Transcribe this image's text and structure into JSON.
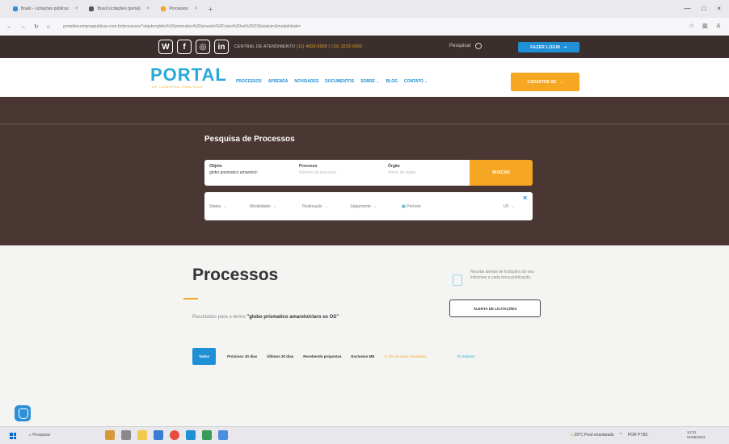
{
  "browser": {
    "tabs": [
      {
        "title": "Brasil - Licitações públicas",
        "color": "#2d8fd6"
      },
      {
        "title": "Brasil Licitações (portal)",
        "color": "#555555"
      },
      {
        "title": "Processos",
        "color": "#f5a623"
      }
    ],
    "url": "portaldecompraspublicas.com.br/processos?objeto=globo%20prismatico%20amarelo%2Fclaro%20so%20OS&status=&modalidade=",
    "window_controls": [
      "—",
      "□",
      "×"
    ]
  },
  "topbar": {
    "social": [
      "W",
      "f",
      "◎",
      "in"
    ],
    "central": "CENTRAL DE ATENDIMENTO",
    "phone": "(11) 4003-0000 / (19) 3232-0000",
    "search_label": "Pesquisar",
    "login_label": "FAZER LOGIN"
  },
  "header": {
    "logo": "PORTAL",
    "logo_sub": "DE COMPRAS PÚBLICAS",
    "menu": [
      "PROCESSOS",
      "APRENDA",
      "NOVIDADES",
      "DOCUMENTOS",
      "SOBRE",
      "BLOG",
      "CONTATO"
    ],
    "register_label": "CADASTRE-SE"
  },
  "search": {
    "title": "Pesquisa de Processos",
    "fields": [
      {
        "label": "Objeto",
        "value": "globo prismatico amarelo/c",
        "placeholder": ""
      },
      {
        "label": "Processo",
        "value": "",
        "placeholder": "Número do processo"
      },
      {
        "label": "Órgão",
        "value": "",
        "placeholder": "Nome do órgão"
      }
    ],
    "button": "BUSCAR",
    "filters": [
      "Status",
      "Modalidade",
      "Realização",
      "Julgamento",
      "Período",
      "UF"
    ],
    "close": "×"
  },
  "content": {
    "title": "Processos",
    "result_prefix": "Resultados para o termo",
    "result_term": "\"globo prismatico amarelo/claro so OS\"",
    "alert_text": "Receba alertas de licitações do seu interesse a cada nova publicação.",
    "alert_button": "ALERTA DE LICITAÇÕES",
    "tabs": [
      {
        "label": "Todos",
        "style": "active"
      },
      {
        "label": "Próximos 30 dias",
        "style": ""
      },
      {
        "label": "Últimos 30 dias",
        "style": ""
      },
      {
        "label": "Recebendo propostas",
        "style": ""
      },
      {
        "label": "Exclusivo ME",
        "style": ""
      },
      {
        "label": "Ver os meus resultados",
        "style": "orange"
      },
      {
        "label": "Ordenar",
        "style": "blue"
      }
    ]
  },
  "taskbar": {
    "search": "Pesquisar",
    "weather": "29°C  Pred ensolarado",
    "lang": "POR PTB2",
    "time": "14:21",
    "date": "01/06/2023"
  }
}
